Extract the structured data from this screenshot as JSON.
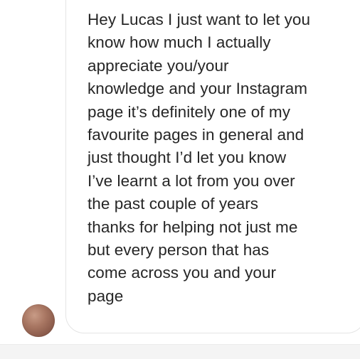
{
  "conversation": {
    "message": {
      "text": "Hey Lucas I just want to let you\nknow how much I actually\nappreciate you/your\nknowledge and your Instagram\npage it’s definitely one of my\nfavourite pages in general and\njust thought I’d let you know\nI’ve learnt a lot from you over\nthe past couple of years\nthanks for helping not just me\nbut every person that has\ncome across you and your\npage"
    }
  },
  "colors": {
    "bubble_border": "#e4e4e4",
    "text": "#262626",
    "background": "#ffffff",
    "bottom_strip": "#f4f4f4"
  }
}
